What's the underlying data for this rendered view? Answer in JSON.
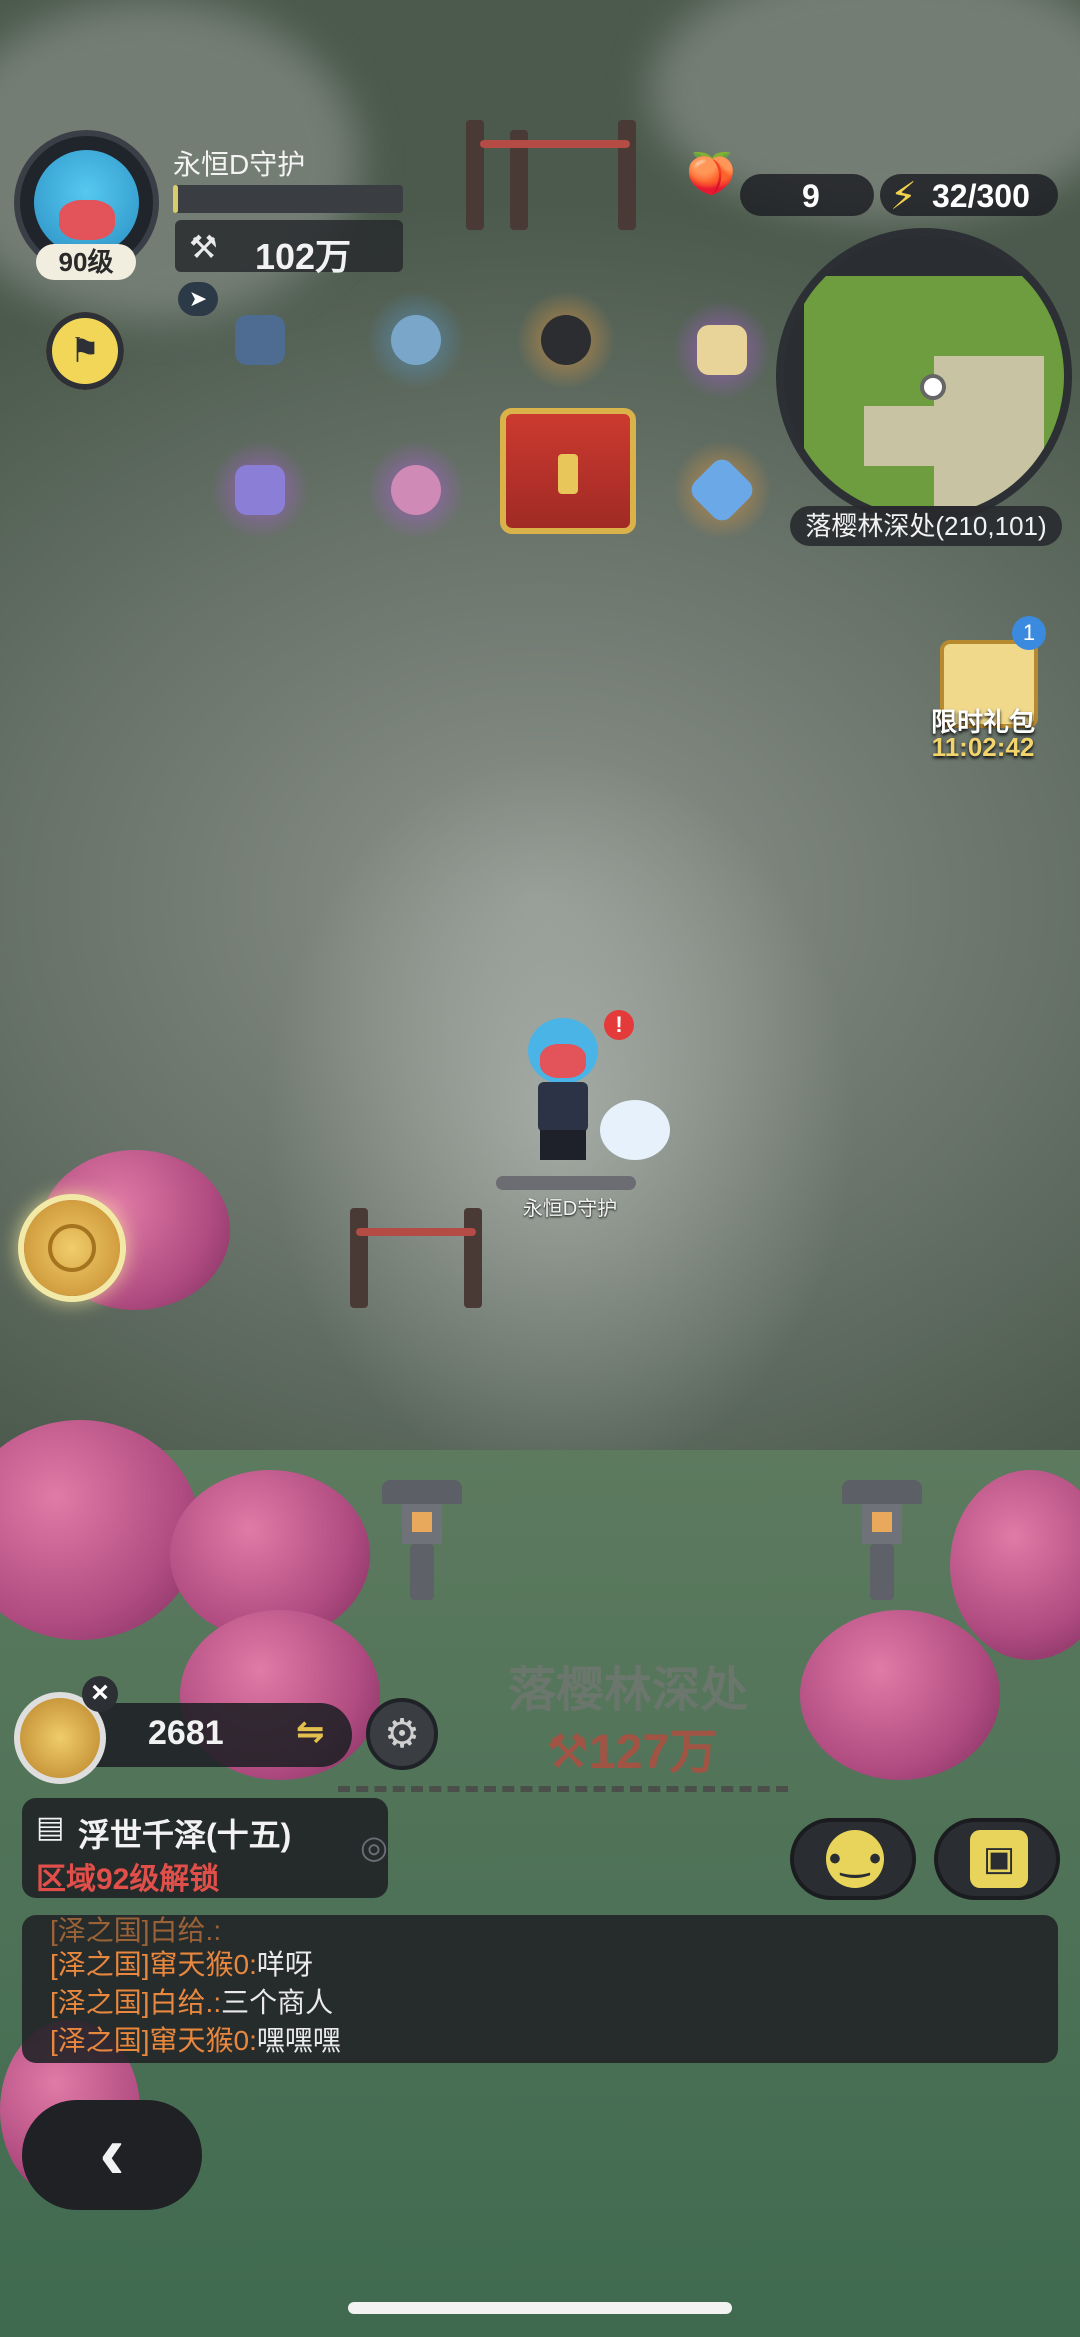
{
  "player": {
    "name": "永恒D守护",
    "level": "90级",
    "xp_fraction": 0.02,
    "power": "102万",
    "power_icon": "crossed-tools-icon"
  },
  "resources": {
    "peach_value": "9",
    "energy_value": "32/300",
    "energy_icon": "lightning-icon"
  },
  "minimap": {
    "location": "落樱林深处(210,101)"
  },
  "gift": {
    "label": "限时礼包",
    "timer": "11:02:42",
    "badge": "1"
  },
  "character": {
    "name": "永恒D守护",
    "alert": "!"
  },
  "zone": {
    "name": "落樱林深处",
    "required_power": "127万",
    "power_icon": "crossed-tools-icon"
  },
  "coins": {
    "value": "2681",
    "close": "×",
    "swap": "⇋"
  },
  "quest": {
    "title": "浮世千泽(十五)",
    "subtitle": "区域92级解锁"
  },
  "chat": [
    {
      "tag": "[泽之国]窜天猴0:",
      "msg": "咩呀"
    },
    {
      "tag": "[泽之国]白给.:",
      "msg": "三个商人"
    },
    {
      "tag": "[泽之国]窜天猴0:",
      "msg": "嘿嘿嘿"
    }
  ],
  "colors": {
    "accent_gold": "#e8d45a",
    "warning_red": "#e04f4a",
    "chat_tag": "#e8873e"
  }
}
